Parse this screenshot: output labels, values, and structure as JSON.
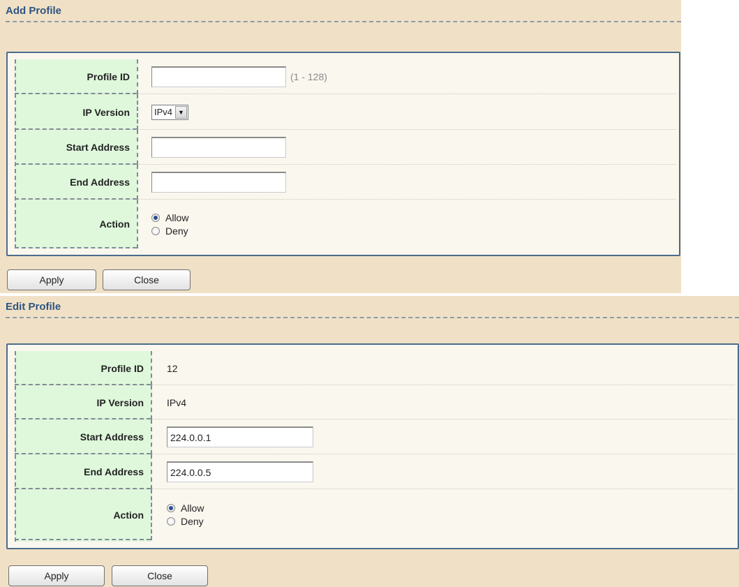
{
  "add_profile": {
    "title": "Add Profile",
    "fields": {
      "profile_id_label": "Profile ID",
      "profile_id_value": "",
      "profile_id_hint": "(1 - 128)",
      "ip_version_label": "IP Version",
      "ip_version_selected": "IPv4",
      "start_address_label": "Start Address",
      "start_address_value": "",
      "end_address_label": "End Address",
      "end_address_value": "",
      "action_label": "Action",
      "action_options": [
        "Allow",
        "Deny"
      ],
      "action_selected": "Allow"
    },
    "buttons": {
      "apply": "Apply",
      "close": "Close"
    }
  },
  "edit_profile": {
    "title": "Edit Profile",
    "fields": {
      "profile_id_label": "Profile ID",
      "profile_id_value": "12",
      "ip_version_label": "IP Version",
      "ip_version_value": "IPv4",
      "start_address_label": "Start Address",
      "start_address_value": "224.0.0.1",
      "end_address_label": "End Address",
      "end_address_value": "224.0.0.5",
      "action_label": "Action",
      "action_options": [
        "Allow",
        "Deny"
      ],
      "action_selected": "Allow"
    },
    "buttons": {
      "apply": "Apply",
      "close": "Close"
    }
  },
  "colors": {
    "panel_background": "#f0e1c6",
    "form_background": "#faf7ef",
    "label_column": "#dff8dc",
    "title_text": "#2f5482",
    "form_border": "#4b6c8c"
  },
  "icons": {
    "dropdown": "chevron-down-icon",
    "radio": "radio-icon"
  }
}
